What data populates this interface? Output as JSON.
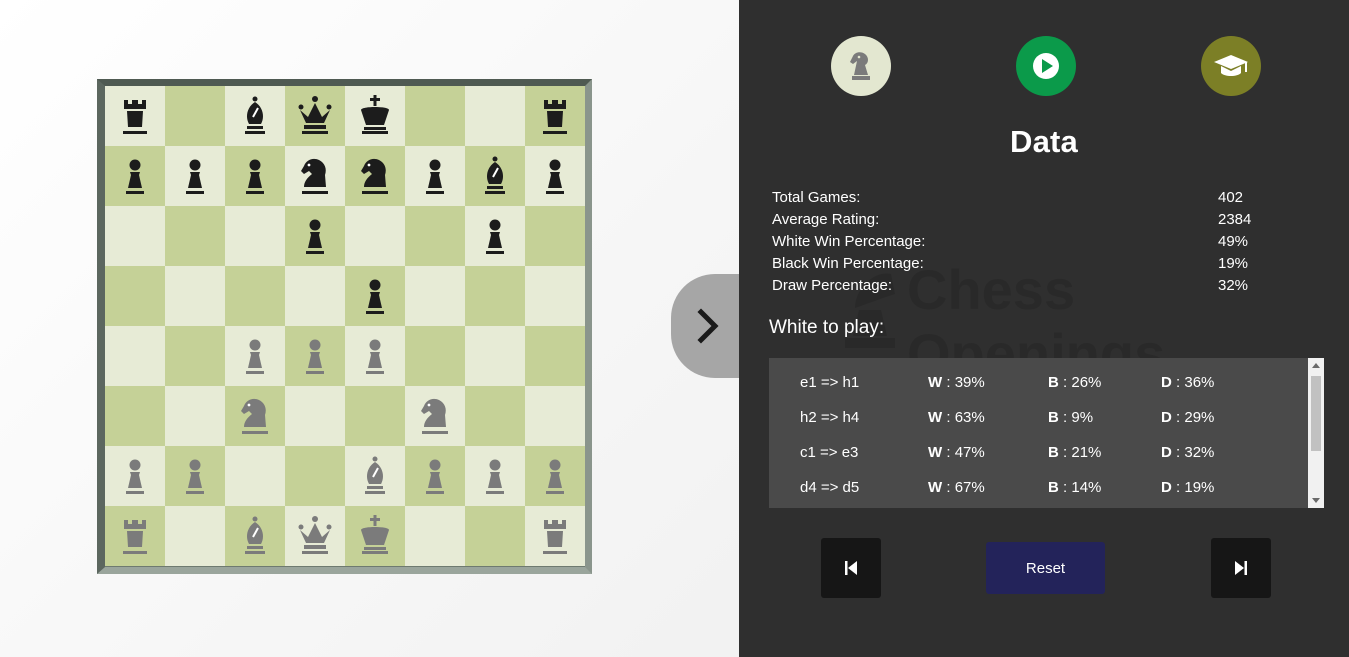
{
  "board": {
    "light_color": "#e7ebd6",
    "dark_color": "#c5d197",
    "ranks": [
      [
        [
          "b",
          "rook"
        ],
        null,
        [
          "b",
          "bishop"
        ],
        [
          "b",
          "queen"
        ],
        [
          "b",
          "king"
        ],
        null,
        null,
        [
          "b",
          "rook"
        ]
      ],
      [
        [
          "b",
          "pawn"
        ],
        [
          "b",
          "pawn"
        ],
        [
          "b",
          "pawn"
        ],
        [
          "b",
          "knight"
        ],
        [
          "b",
          "knight"
        ],
        [
          "b",
          "pawn"
        ],
        [
          "b",
          "bishop"
        ],
        [
          "b",
          "pawn"
        ]
      ],
      [
        null,
        null,
        null,
        [
          "b",
          "pawn"
        ],
        null,
        null,
        [
          "b",
          "pawn"
        ],
        null
      ],
      [
        null,
        null,
        null,
        null,
        [
          "b",
          "pawn"
        ],
        null,
        null,
        null
      ],
      [
        null,
        null,
        [
          "w",
          "pawn"
        ],
        [
          "w",
          "pawn"
        ],
        [
          "w",
          "pawn"
        ],
        null,
        null,
        null
      ],
      [
        null,
        null,
        [
          "w",
          "knight"
        ],
        null,
        null,
        [
          "w",
          "knight"
        ],
        null,
        null
      ],
      [
        [
          "w",
          "pawn"
        ],
        [
          "w",
          "pawn"
        ],
        null,
        null,
        [
          "w",
          "bishop"
        ],
        [
          "w",
          "pawn"
        ],
        [
          "w",
          "pawn"
        ],
        [
          "w",
          "pawn"
        ]
      ],
      [
        [
          "w",
          "rook"
        ],
        null,
        [
          "w",
          "bishop"
        ],
        [
          "w",
          "queen"
        ],
        [
          "w",
          "king"
        ],
        null,
        null,
        [
          "w",
          "rook"
        ]
      ]
    ]
  },
  "toggle": {
    "icon": "chevron-right-icon"
  },
  "panel": {
    "modes": [
      {
        "icon": "knight-icon",
        "color": "#e3e7d0"
      },
      {
        "icon": "play-icon",
        "color": "#0b9a4a"
      },
      {
        "icon": "graduation-cap-icon",
        "color": "#7c7f26"
      }
    ],
    "watermark": {
      "line1": "Chess",
      "line2": "Openings"
    },
    "title": "Data",
    "stats": [
      {
        "label": "Total Games:",
        "value": "402"
      },
      {
        "label": "Average Rating:",
        "value": "2384"
      },
      {
        "label": "White Win Percentage:",
        "value": "49%"
      },
      {
        "label": "Black Win Percentage:",
        "value": "19%"
      },
      {
        "label": "Draw Percentage:",
        "value": "32%"
      }
    ],
    "to_play": "White to play:",
    "moves": [
      {
        "move": "e1 => h1",
        "w": "39%",
        "b": "26%",
        "d": "36%"
      },
      {
        "move": "h2 => h4",
        "w": "63%",
        "b": "9%",
        "d": "29%"
      },
      {
        "move": "c1 => e3",
        "w": "47%",
        "b": "21%",
        "d": "32%"
      },
      {
        "move": "d4 => d5",
        "w": "67%",
        "b": "14%",
        "d": "19%"
      }
    ],
    "labels": {
      "w": "W",
      "b": "B",
      "d": "D"
    },
    "reset_label": "Reset",
    "prev_icon": "skip-back-icon",
    "next_icon": "skip-forward-icon"
  }
}
